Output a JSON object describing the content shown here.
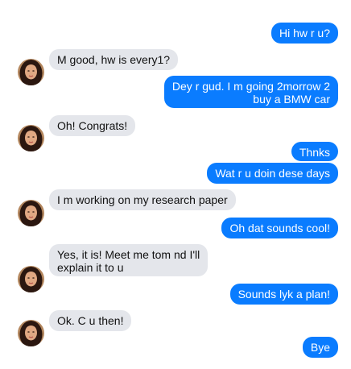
{
  "conversation": {
    "messages": [
      {
        "from": "me",
        "text": "Hi hw r u?"
      },
      {
        "from": "contact",
        "text": "M good, hw is every1?"
      },
      {
        "from": "me",
        "text": "Dey r gud. I m going 2morrow 2\nbuy a BMW car"
      },
      {
        "from": "contact",
        "text": "Oh! Congrats!"
      },
      {
        "from": "me",
        "text": "Thnks"
      },
      {
        "from": "me",
        "text": "Wat r u doin dese days"
      },
      {
        "from": "contact",
        "text": "I m working on my research paper"
      },
      {
        "from": "me",
        "text": "Oh dat sounds cool!"
      },
      {
        "from": "contact",
        "text": "Yes, it is! Meet me tom nd I'll\nexplain it to u"
      },
      {
        "from": "me",
        "text": "Sounds lyk a plan!"
      },
      {
        "from": "contact",
        "text": "Ok. C u then!"
      },
      {
        "from": "me",
        "text": "Bye"
      }
    ]
  },
  "colors": {
    "sent_bubble": "#0a7cff",
    "received_bubble": "#e4e6eb",
    "sent_text": "#ffffff",
    "received_text": "#111111"
  },
  "icons": {
    "avatar": "contact-avatar-photo"
  }
}
